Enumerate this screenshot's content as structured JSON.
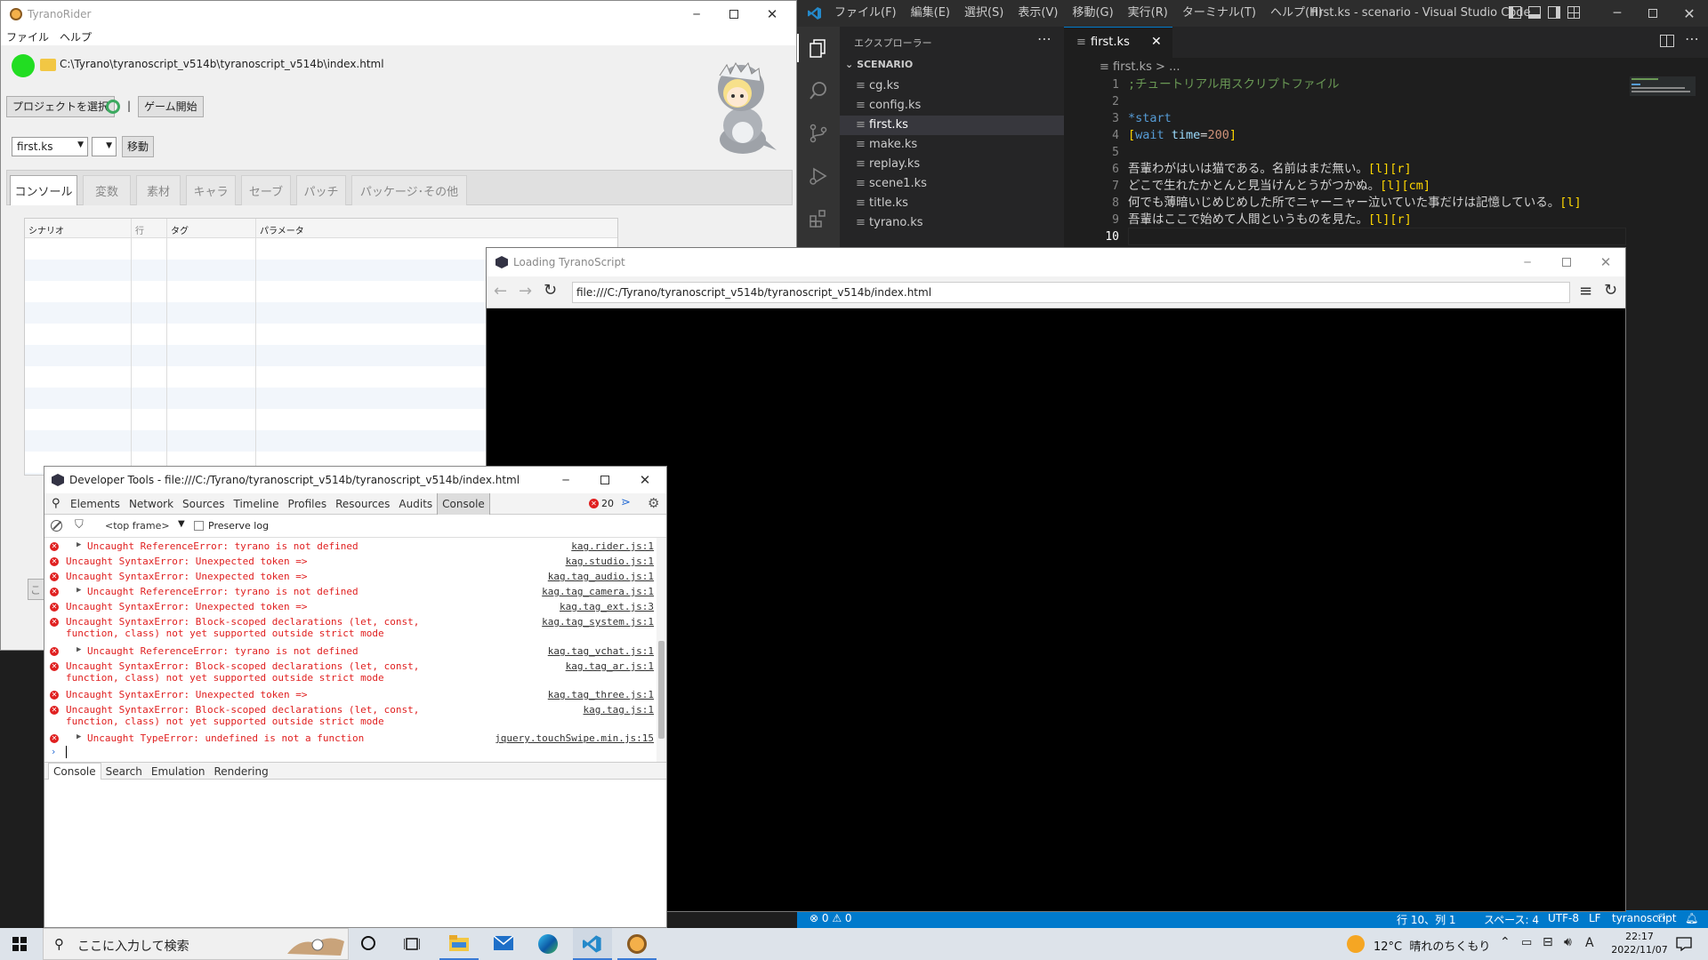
{
  "tyranorider": {
    "title": "TyranoRider",
    "menu": [
      "ファイル",
      "ヘルプ"
    ],
    "path": "C:\\Tyrano\\tyranoscript_v514b\\tyranoscript_v514b\\index.html",
    "select_project": "プロジェクトを選択",
    "separator": "|",
    "start_game": "ゲーム開始",
    "file_select": "first.ks",
    "go_button": "移動",
    "tabs": [
      "コンソール",
      "変数",
      "素材",
      "キャラ",
      "セーブ",
      "パッチ",
      "パッケージ･その他"
    ],
    "table_headers": [
      "シナリオ",
      "行",
      "タグ",
      "パラメータ"
    ],
    "hidden_button_fragment": "こ"
  },
  "vscode": {
    "menu": [
      "ファイル(F)",
      "編集(E)",
      "選択(S)",
      "表示(V)",
      "移動(G)",
      "実行(R)",
      "ターミナル(T)",
      "ヘルプ(H)"
    ],
    "title": "first.ks - scenario - Visual Studio Code",
    "explorer_title": "エクスプローラー",
    "folder": "SCENARIO",
    "files": [
      "cg.ks",
      "config.ks",
      "first.ks",
      "make.ks",
      "replay.ks",
      "scene1.ks",
      "title.ks",
      "tyrano.ks"
    ],
    "active_file": "first.ks",
    "tab": "first.ks",
    "breadcrumb_file": "first.ks",
    "breadcrumb_sep": ">",
    "breadcrumb_rest": "...",
    "line_numbers": [
      "1",
      "2",
      "3",
      "4",
      "5",
      "6",
      "7",
      "8",
      "9",
      "10"
    ],
    "lines": {
      "l1": ";チュートリアル用スクリプトファイル",
      "l3": "*start",
      "l4_open": "[",
      "l4_tag": "wait",
      "l4_attr": " time",
      "l4_eq": "=",
      "l4_val": "200",
      "l4_close": "]",
      "l6_text": "吾輩わがはいは猫である。名前はまだ無い。",
      "l6_tags": "[l][r]",
      "l7_text": "どこで生れたかとんと見当けんとうがつかぬ。",
      "l7_tags": "[l][cm]",
      "l8_text": "何でも薄暗いじめじめした所でニャーニャー泣いていた事だけは記憶している。",
      "l8_tags": "[l]",
      "l9_text": "吾輩はここで始めて人間というものを見た。",
      "l9_tags": "[l][r]"
    },
    "status": {
      "errors": "⊗ 0 ⚠ 0",
      "position": "行 10、列 1",
      "spaces": "スペース: 4",
      "encoding": "UTF-8",
      "eol": "LF",
      "language": "tyranoscript"
    }
  },
  "browser": {
    "title": "Loading TyranoScript",
    "url": "file:///C:/Tyrano/tyranoscript_v514b/tyranoscript_v514b/index.html"
  },
  "devtools": {
    "title": "Developer Tools - file:///C:/Tyrano/tyranoscript_v514b/tyranoscript_v514b/index.html",
    "tabs": [
      "Elements",
      "Network",
      "Sources",
      "Timeline",
      "Profiles",
      "Resources",
      "Audits",
      "Console"
    ],
    "error_count": "20",
    "frame": "<top frame>",
    "preserve_log": "Preserve log",
    "messages": [
      {
        "text": "Uncaught ReferenceError: tyrano is not defined",
        "src": "kag.rider.js:1",
        "expandable": true
      },
      {
        "text": "Uncaught SyntaxError: Unexpected token =>",
        "src": "kag.studio.js:1",
        "expandable": false
      },
      {
        "text": "Uncaught SyntaxError: Unexpected token =>",
        "src": "kag.tag_audio.js:1",
        "expandable": false
      },
      {
        "text": "Uncaught ReferenceError: tyrano is not defined",
        "src": "kag.tag_camera.js:1",
        "expandable": true
      },
      {
        "text": "Uncaught SyntaxError: Unexpected token =>",
        "src": "kag.tag_ext.js:3",
        "expandable": false
      },
      {
        "text": "Uncaught SyntaxError: Block-scoped declarations (let, const, function, class) not yet supported outside strict mode",
        "src": "kag.tag_system.js:1",
        "expandable": false
      },
      {
        "text": "Uncaught ReferenceError: tyrano is not defined",
        "src": "kag.tag_vchat.js:1",
        "expandable": true
      },
      {
        "text": "Uncaught SyntaxError: Block-scoped declarations (let, const, function, class) not yet supported outside strict mode",
        "src": "kag.tag_ar.js:1",
        "expandable": false
      },
      {
        "text": "Uncaught SyntaxError: Unexpected token =>",
        "src": "kag.tag_three.js:1",
        "expandable": false
      },
      {
        "text": "Uncaught SyntaxError: Block-scoped declarations (let, const, function, class) not yet supported outside strict mode",
        "src": "kag.tag.js:1",
        "expandable": false
      },
      {
        "text": "Uncaught TypeError: undefined is not a function",
        "src": "jquery.touchSwipe.min.js:15",
        "expandable": true
      }
    ],
    "drawer_tabs": [
      "Console",
      "Search",
      "Emulation",
      "Rendering"
    ]
  },
  "taskbar": {
    "search_placeholder": "ここに入力して検索",
    "weather": "12°C  晴れのちくもり",
    "ime": "A",
    "time": "22:17",
    "date": "2022/11/07"
  }
}
